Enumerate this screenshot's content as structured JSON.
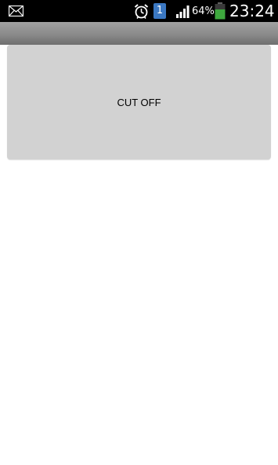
{
  "status_bar": {
    "icons": [
      "mail-icon",
      "alarm-icon",
      "notification-badge",
      "signal-icon",
      "battery-icon"
    ],
    "notification_count": "1",
    "battery_percent": "64%",
    "time": "23:24",
    "battery_color": "#3ea83e",
    "badge_color": "#3b78c2"
  },
  "main": {
    "cut_off_button_label": "CUT OFF"
  }
}
